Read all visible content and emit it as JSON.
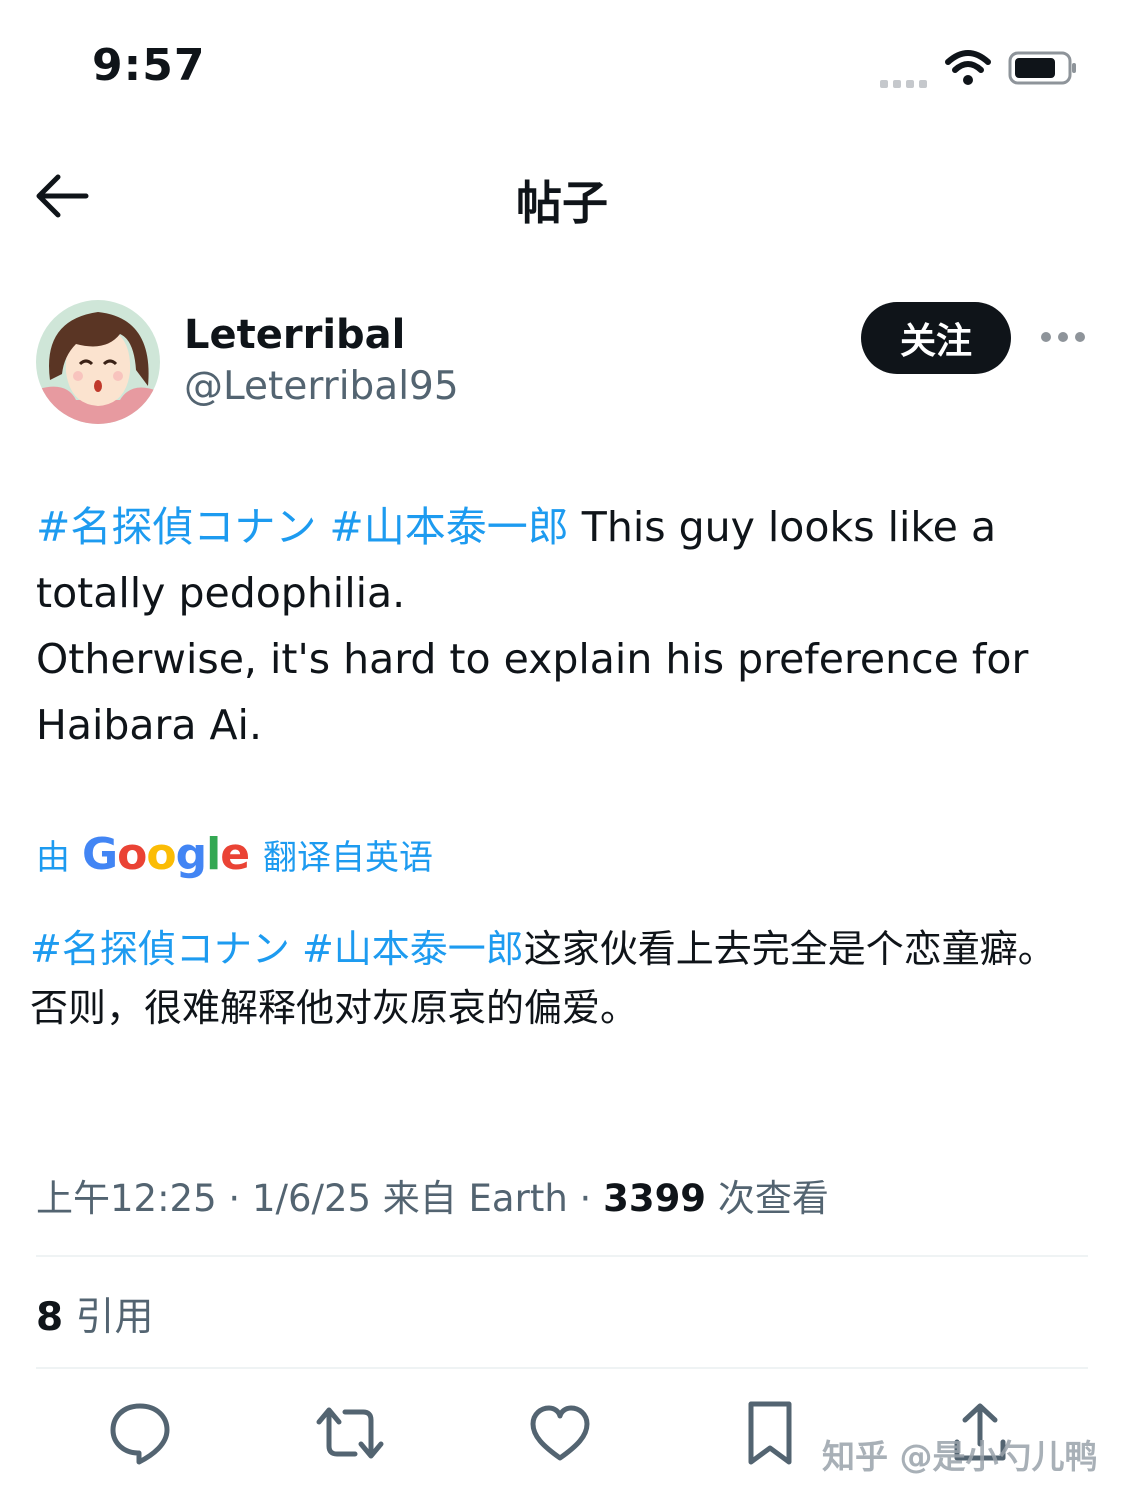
{
  "status_bar": {
    "time": "9:57"
  },
  "nav": {
    "title": "帖子"
  },
  "author": {
    "display_name": "Leterribal",
    "handle": "@Leterribal95",
    "follow_label": "关注"
  },
  "post": {
    "hashtag_1": "#名探偵コナン",
    "hashtag_2": "#山本泰一郎",
    "text_line_1": " This guy looks like a totally pedophilia.",
    "text_line_2": "Otherwise, it's hard to explain his preference for Haibara Ai."
  },
  "translation": {
    "prefix": "由",
    "provider": "Google",
    "suffix": "翻译自英语",
    "hashtag_1": "#名探偵コナン",
    "hashtag_2": "#山本泰一郎",
    "text_line_1": "这家伙看上去完全是个恋童癖。",
    "text_line_2": "否则，很难解释他对灰原哀的偏爱。"
  },
  "meta": {
    "time": "上午12:25",
    "date": "1/6/25",
    "source": "来自 Earth",
    "views_count": "3399",
    "views_label": "次查看"
  },
  "stats": {
    "quotes_count": "8",
    "quotes_label": "引用"
  },
  "watermark": "知乎 @是小勺儿鸭",
  "colors": {
    "link": "#1d9bf0",
    "text": "#0f1419",
    "secondary": "#536471",
    "divider": "#eff3f4"
  }
}
